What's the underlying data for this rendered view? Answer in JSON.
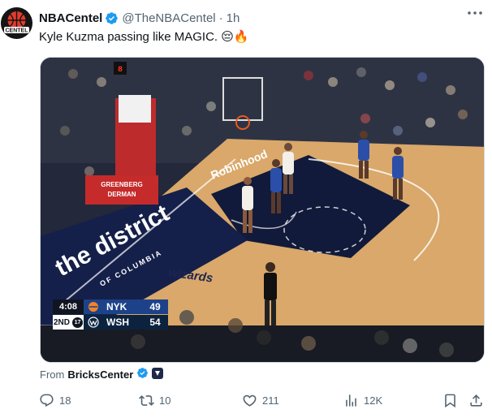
{
  "author": {
    "name": "NBACentel",
    "handle": "@TheNBACentel",
    "time": "1h",
    "separator": "·",
    "avatar_text": "CENTEL"
  },
  "more_label": "···",
  "tweet": {
    "text": "Kyle Kuzma passing like MAGIC.",
    "emojis": "😔🔥"
  },
  "media": {
    "court_text_main": "the district",
    "court_text_sub": "OF COLUMBIA",
    "court_brand": "wizards",
    "baseline_text": "Robinhood",
    "banner_text_1": "GREENBERG",
    "banner_text_2": "DERMAN",
    "shot_clock": "8",
    "scoreboard": {
      "clock": "4:08",
      "quarter": "2ND",
      "shot": "17",
      "teams": [
        {
          "abbr": "NYK",
          "score": "49",
          "color": "#1d428a",
          "accent": "#f58426"
        },
        {
          "abbr": "WSH",
          "score": "54",
          "color": "#0c2340",
          "accent": "#e31837"
        }
      ]
    }
  },
  "source": {
    "prefix": "From",
    "name": "BricksCenter"
  },
  "actions": {
    "replies": "18",
    "retweets": "10",
    "likes": "211",
    "views": "12K"
  },
  "colors": {
    "verified": "#1d9bf0",
    "muted": "#536471",
    "text": "#0f1419"
  }
}
